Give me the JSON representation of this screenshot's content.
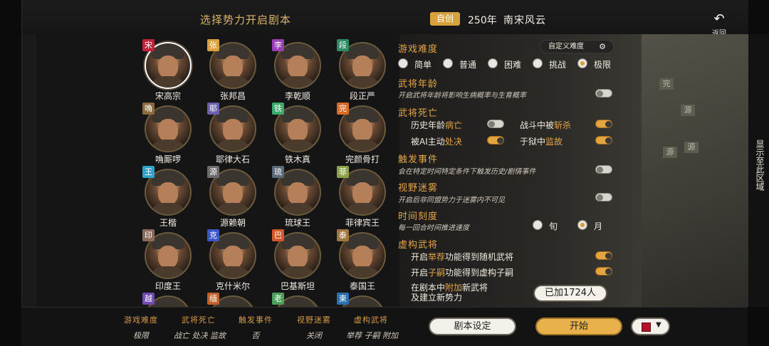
{
  "header": {
    "title": "选择势力开启剧本",
    "badge": "自创",
    "year": "250年",
    "scenario": "南宋风云",
    "back_label": "返回",
    "back_icon": "undo-arrow-icon"
  },
  "side_label": "显示至此区域",
  "roster": [
    {
      "tag": "宋",
      "tag_color": "#c0223a",
      "name": "宋高宗",
      "selected": true
    },
    {
      "tag": "张",
      "tag_color": "#d7a23b",
      "name": "张邦昌"
    },
    {
      "tag": "李",
      "tag_color": "#9a3fb3",
      "name": "李乾顺"
    },
    {
      "tag": "段",
      "tag_color": "#2d8c61",
      "name": "段正严"
    },
    {
      "tag": "唃",
      "tag_color": "#8b6b3e",
      "name": "唃厮啰"
    },
    {
      "tag": "耶",
      "tag_color": "#6b5fb0",
      "name": "耶律大石"
    },
    {
      "tag": "铁",
      "tag_color": "#3fa86b",
      "name": "铁木真"
    },
    {
      "tag": "完",
      "tag_color": "#d86b25",
      "name": "完颜骨打"
    },
    {
      "tag": "王",
      "tag_color": "#2fa2c9",
      "name": "王楷"
    },
    {
      "tag": "源",
      "tag_color": "#6b6b6b",
      "name": "源赖朝"
    },
    {
      "tag": "琉",
      "tag_color": "#5b6a78",
      "name": "琉球王"
    },
    {
      "tag": "菲",
      "tag_color": "#8aa14a",
      "name": "菲律宾王"
    },
    {
      "tag": "印",
      "tag_color": "#8a6a5a",
      "name": "印度王"
    },
    {
      "tag": "克",
      "tag_color": "#3a58c4",
      "name": "克什米尔"
    },
    {
      "tag": "巴",
      "tag_color": "#d2572b",
      "name": "巴基斯坦"
    },
    {
      "tag": "泰",
      "tag_color": "#a0763d",
      "name": "泰国王"
    },
    {
      "tag": "越",
      "tag_color": "#6f4ab0",
      "name": ""
    },
    {
      "tag": "缅",
      "tag_color": "#c0602a",
      "name": ""
    },
    {
      "tag": "老",
      "tag_color": "#4aa05a",
      "name": ""
    },
    {
      "tag": "柬",
      "tag_color": "#2a6fb0",
      "name": ""
    }
  ],
  "settings": {
    "difficulty": {
      "title": "游戏难度",
      "custom_label": "自定义难度",
      "custom_icon": "gear-icon",
      "options": [
        "简单",
        "普通",
        "困难",
        "挑战",
        "极限"
      ],
      "selected": "极限"
    },
    "age": {
      "title": "武将年龄",
      "desc": "开启武将年龄将影响生病概率与生育概率",
      "on": false
    },
    "death": {
      "title": "武将死亡",
      "items": [
        {
          "pre": "历史年龄",
          "hl": "病亡",
          "post": "",
          "on": false
        },
        {
          "pre": "战斗中被",
          "hl": "斩杀",
          "post": "",
          "on": true
        },
        {
          "pre": "被AI主动",
          "hl": "处决",
          "post": "",
          "on": true
        },
        {
          "pre": "于狱中",
          "hl": "监故",
          "post": "",
          "on": true
        }
      ]
    },
    "events": {
      "title": "触发事件",
      "desc": "会在特定时间特定条件下触发历史/剧情事件",
      "on": false
    },
    "fog": {
      "title": "视野迷雾",
      "desc": "开启后非同盟势力于迷雾内不可见",
      "on": false
    },
    "time": {
      "title": "时间刻度",
      "desc": "每一回合时间推进速度",
      "options": [
        "旬",
        "月"
      ],
      "selected": "月"
    },
    "virtual": {
      "title": "虚构武将",
      "items": [
        {
          "pre": "开启",
          "hl": "举荐",
          "post": "功能得到随机武将",
          "on": true
        },
        {
          "pre": "开启",
          "hl": "子嗣",
          "post": "功能得到虚构子嗣",
          "on": true
        }
      ],
      "add_line1_pre": "在剧本中",
      "add_line1_hl": "附加",
      "add_line1_post": "新武将",
      "add_line2": "及建立新势力",
      "added_label": "已加1724人"
    }
  },
  "map_labels": [
    "完",
    "源",
    "源",
    "源"
  ],
  "summary": [
    {
      "k": "游戏难度",
      "v": "极限"
    },
    {
      "k": "武将死亡",
      "v": "战亡 处决 监故"
    },
    {
      "k": "触发事件",
      "v": "否"
    },
    {
      "k": "视野迷雾",
      "v": "关闭"
    },
    {
      "k": "虚构武将",
      "v": "举荐 子嗣 附加"
    }
  ],
  "buttons": {
    "script_settings": "剧本设定",
    "start": "开始",
    "color": "#b3122a"
  }
}
